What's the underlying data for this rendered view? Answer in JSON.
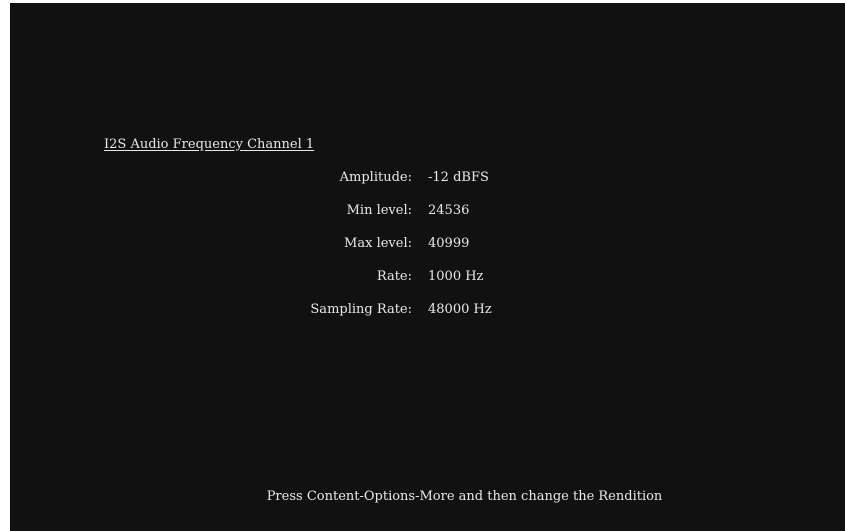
{
  "screen": {
    "title": "I2S Audio Frequency Channel 1",
    "fields": [
      {
        "label": "Amplitude:",
        "value": "-12 dBFS"
      },
      {
        "label": "Min level:",
        "value": "24536"
      },
      {
        "label": "Max level:",
        "value": "40999"
      },
      {
        "label": "Rate:",
        "value": "1000 Hz"
      },
      {
        "label": "Sampling Rate:",
        "value": "48000 Hz"
      }
    ],
    "hint": "Press Content-Options-More and then change the Rendition"
  },
  "colors": {
    "background": "#111111",
    "text": "#e8e8e8"
  }
}
